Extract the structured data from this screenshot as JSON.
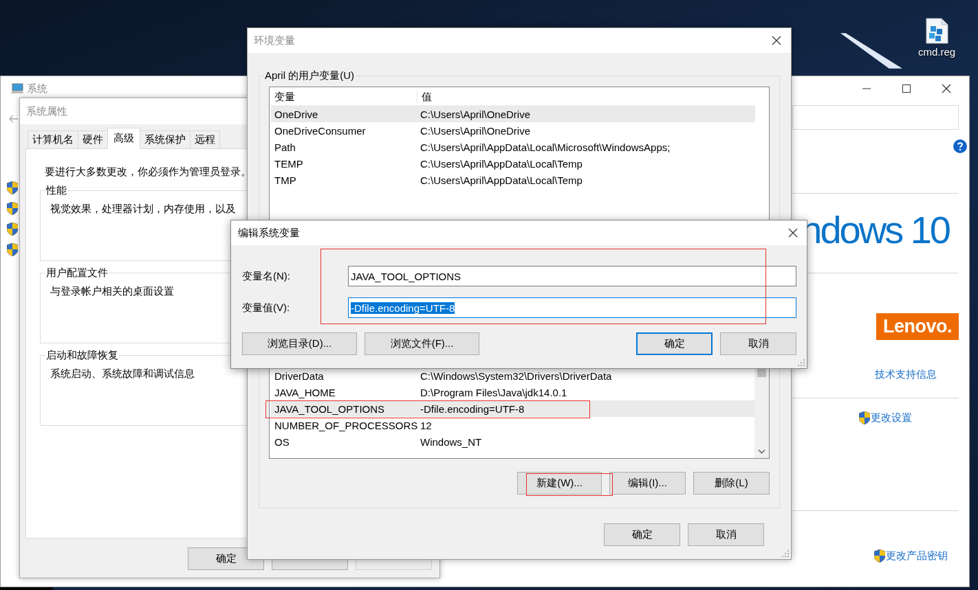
{
  "desktop": {
    "icons": [
      {
        "label": "cmd.reg"
      }
    ]
  },
  "system_window": {
    "title": "系统",
    "logo_text": "ndows 10",
    "maker_logo": "Lenovo.",
    "links": [
      {
        "label": "技术支持信息",
        "shield": false
      },
      {
        "label": "更改设置",
        "shield": true
      },
      {
        "label": "更改产品密钥",
        "shield": true
      }
    ]
  },
  "system_properties": {
    "title": "系统属性",
    "tabs": [
      {
        "label": "计算机名",
        "selected": false
      },
      {
        "label": "硬件",
        "selected": false
      },
      {
        "label": "高级",
        "selected": true
      },
      {
        "label": "系统保护",
        "selected": false
      },
      {
        "label": "远程",
        "selected": false
      }
    ],
    "notice": "要进行大多数更改，你必须作为管理员登录。",
    "groups": [
      {
        "title": "性能",
        "text": "视觉效果，处理器计划，内存使用，以及"
      },
      {
        "title": "用户配置文件",
        "text": "与登录帐户相关的桌面设置"
      },
      {
        "title": "启动和故障恢复",
        "text": "系统启动、系统故障和调试信息"
      }
    ],
    "buttons": [
      {
        "label": "确定",
        "disabled": false
      },
      {
        "disabled": false
      },
      {
        "disabled": true
      }
    ]
  },
  "environment_variables": {
    "title": "环境变量",
    "user_variables": {
      "title": "April 的用户变量(U)",
      "columns": [
        "变量",
        "值"
      ],
      "rows": [
        {
          "name": "OneDrive",
          "value": "C:\\Users\\April\\OneDrive",
          "selected": true
        },
        {
          "name": "OneDriveConsumer",
          "value": "C:\\Users\\April\\OneDrive",
          "selected": false
        },
        {
          "name": "Path",
          "value": "C:\\Users\\April\\AppData\\Local\\Microsoft\\WindowsApps;",
          "selected": false
        },
        {
          "name": "TEMP",
          "value": "C:\\Users\\April\\AppData\\Local\\Temp",
          "selected": false
        },
        {
          "name": "TMP",
          "value": "C:\\Users\\April\\AppData\\Local\\Temp",
          "selected": false
        }
      ]
    },
    "system_variables": {
      "rows": [
        {
          "name": "DriverData",
          "value": "C:\\Windows\\System32\\Drivers\\DriverData",
          "selected": false
        },
        {
          "name": "JAVA_HOME",
          "value": "D:\\Program Files\\Java\\jdk14.0.1",
          "selected": false
        },
        {
          "name": "JAVA_TOOL_OPTIONS",
          "value": "-Dfile.encoding=UTF-8",
          "selected": true
        },
        {
          "name": "NUMBER_OF_PROCESSORS",
          "value": "12",
          "selected": false
        },
        {
          "name": "OS",
          "value": "Windows_NT",
          "selected": false
        }
      ],
      "buttons": [
        {
          "label": "新建(W)..."
        },
        {
          "label": "编辑(I)..."
        },
        {
          "label": "删除(L)"
        }
      ]
    },
    "buttons": [
      {
        "label": "确定"
      },
      {
        "label": "取消"
      }
    ]
  },
  "edit_dialog": {
    "title": "编辑系统变量",
    "fields": [
      {
        "label": "变量名(N):",
        "value": "JAVA_TOOL_OPTIONS",
        "focused": false
      },
      {
        "label": "变量值(V):",
        "value": "-Dfile.encoding=UTF-8",
        "focused": true
      }
    ],
    "buttons": [
      {
        "label": "浏览目录(D)...",
        "default": false
      },
      {
        "label": "浏览文件(F)...",
        "default": false
      },
      {
        "label": "确定",
        "default": true
      },
      {
        "label": "取消",
        "default": false
      }
    ]
  }
}
